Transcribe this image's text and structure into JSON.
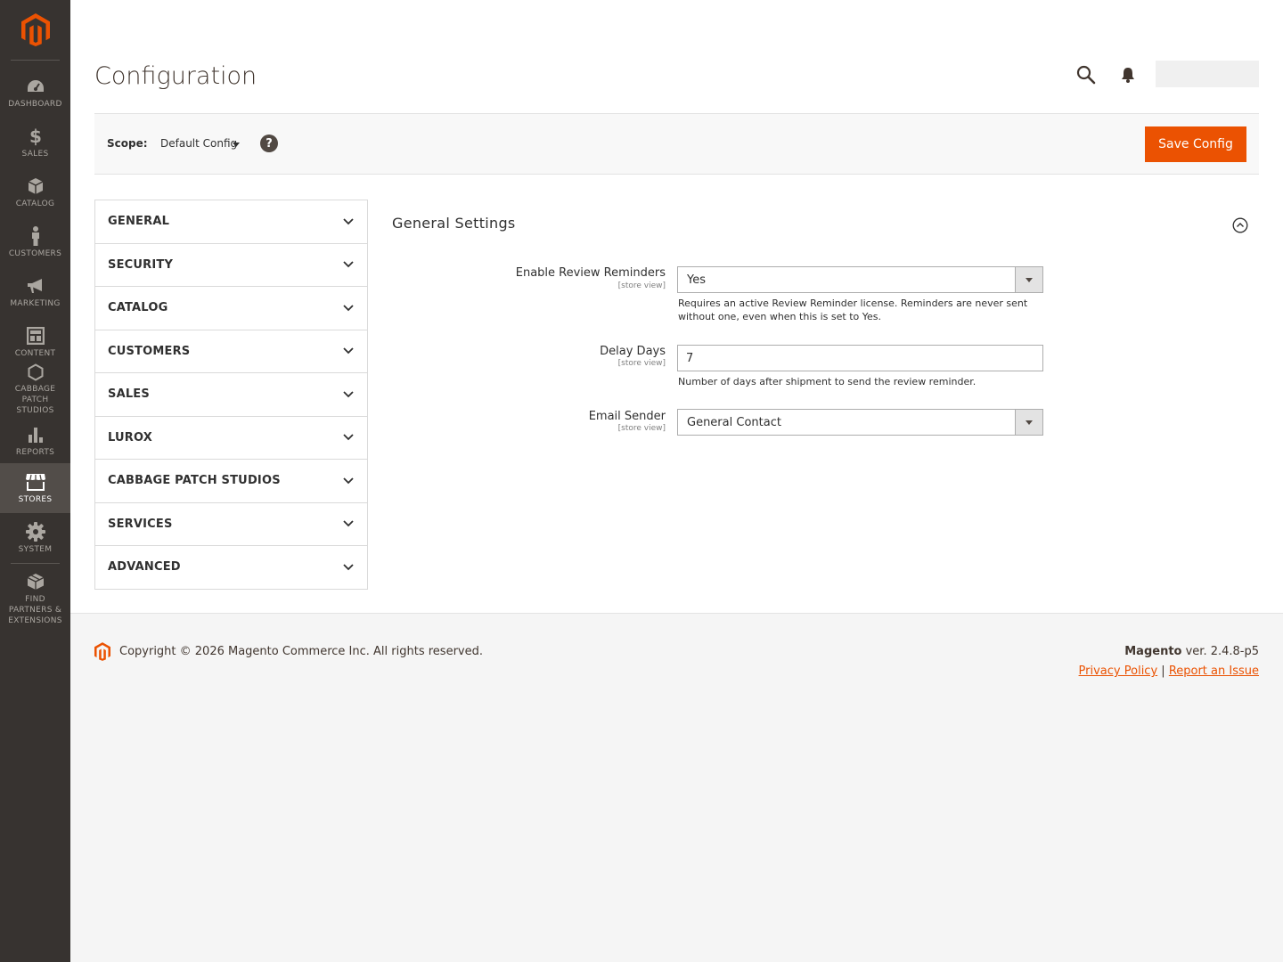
{
  "sidebar": {
    "logo_icon": "magento-logo-icon",
    "items": [
      {
        "label": "DASHBOARD",
        "icon": "dashboard-icon"
      },
      {
        "label": "SALES",
        "icon": "dollar-icon"
      },
      {
        "label": "CATALOG",
        "icon": "box-icon"
      },
      {
        "label": "CUSTOMERS",
        "icon": "person-icon"
      },
      {
        "label": "MARKETING",
        "icon": "megaphone-icon"
      },
      {
        "label": "CONTENT",
        "icon": "layout-icon"
      },
      {
        "label": "CABBAGE PATCH STUDIOS",
        "icon": "hexagon-icon"
      },
      {
        "label": "REPORTS",
        "icon": "bar-chart-icon"
      },
      {
        "label": "STORES",
        "icon": "storefront-icon",
        "active": true
      },
      {
        "label": "SYSTEM",
        "icon": "gear-icon"
      },
      {
        "label": "FIND PARTNERS & EXTENSIONS",
        "icon": "blocks-icon"
      }
    ]
  },
  "header": {
    "title": "Configuration"
  },
  "scope": {
    "label": "Scope:",
    "value": "Default Config",
    "help": "?"
  },
  "actions": {
    "save_label": "Save Config"
  },
  "tabs": [
    "GENERAL",
    "SECURITY",
    "CATALOG",
    "CUSTOMERS",
    "SALES",
    "LUROX",
    "CABBAGE PATCH STUDIOS",
    "SERVICES",
    "ADVANCED"
  ],
  "section": {
    "title": "General Settings",
    "fields": {
      "enable": {
        "label": "Enable Review Reminders",
        "scope": "[store view]",
        "value": "Yes",
        "note": "Requires an active Review Reminder license. Reminders are never sent without one, even when this is set to Yes."
      },
      "delay": {
        "label": "Delay Days",
        "scope": "[store view]",
        "value": "7",
        "note": "Number of days after shipment to send the review reminder."
      },
      "sender": {
        "label": "Email Sender",
        "scope": "[store view]",
        "value": "General Contact"
      }
    }
  },
  "footer": {
    "copyright": "Copyright © 2026 Magento Commerce Inc. All rights reserved.",
    "brand": "Magento",
    "version": " ver. 2.4.8-p5",
    "privacy": "Privacy Policy",
    "separator": " | ",
    "report": "Report an Issue"
  },
  "colors": {
    "accent": "#eb5202",
    "sidebar": "#373330",
    "sidebar_active": "#524d49"
  }
}
